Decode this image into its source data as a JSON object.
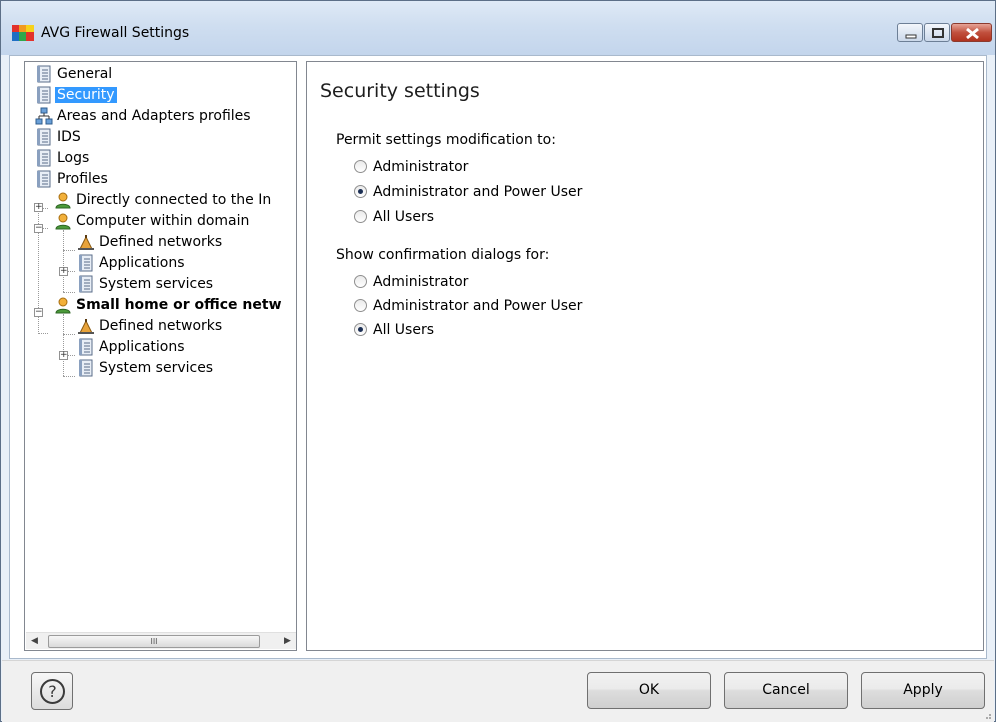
{
  "window": {
    "title": "AVG Firewall Settings"
  },
  "tree": {
    "items": [
      {
        "label": "General"
      },
      {
        "label": "Security"
      },
      {
        "label": "Areas and Adapters profiles"
      },
      {
        "label": "IDS"
      },
      {
        "label": "Logs"
      },
      {
        "label": "Profiles"
      },
      {
        "label": "Directly connected to the In"
      },
      {
        "label": "Computer within domain"
      },
      {
        "label": "Defined networks"
      },
      {
        "label": "Applications"
      },
      {
        "label": "System services"
      },
      {
        "label": "Small home or office netw"
      },
      {
        "label": "Defined networks"
      },
      {
        "label": "Applications"
      },
      {
        "label": "System services"
      }
    ],
    "selected": "Security",
    "scroll_thumb_glyph": "III"
  },
  "panel": {
    "title": "Security settings",
    "permit_group": {
      "label": "Permit settings modification to:",
      "options": [
        "Administrator",
        "Administrator and Power User",
        "All Users"
      ],
      "selected": "Administrator and Power User"
    },
    "confirm_group": {
      "label": "Show confirmation dialogs for:",
      "options": [
        "Administrator",
        "Administrator and Power User",
        "All Users"
      ],
      "selected": "All Users"
    }
  },
  "buttons": {
    "ok": "OK",
    "cancel": "Cancel",
    "apply": "Apply",
    "help_glyph": "?"
  },
  "colors": {
    "selection": "#3399ff",
    "window_frame": "#e9f0f8",
    "close_button": "#c1503d"
  }
}
